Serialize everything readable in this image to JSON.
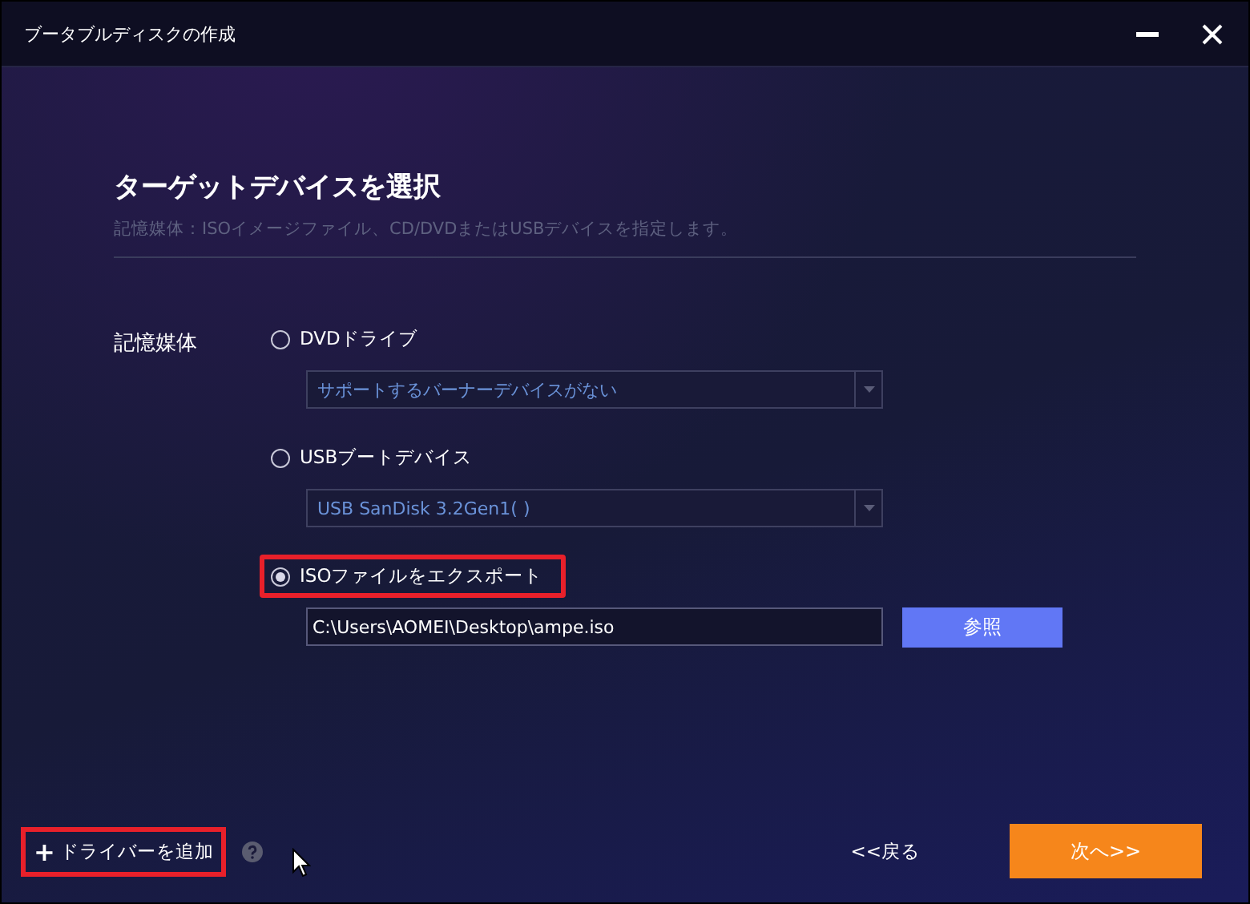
{
  "window": {
    "title": "ブータブルディスクの作成"
  },
  "heading": "ターゲットデバイスを選択",
  "subtitle": "記憶媒体：ISOイメージファイル、CD/DVDまたはUSBデバイスを指定します。",
  "media_label": "記憶媒体",
  "options": [
    {
      "kind": "dropdown",
      "label": "DVDドライブ",
      "selected": false,
      "highlighted": false,
      "value": "サポートするバーナーデバイスがない"
    },
    {
      "kind": "dropdown",
      "label": "USBブートデバイス",
      "selected": false,
      "highlighted": false,
      "value": "USB SanDisk 3.2Gen1( )"
    },
    {
      "kind": "path",
      "label": "ISOファイルをエクスポート",
      "selected": true,
      "highlighted": true,
      "value": "C:\\Users\\AOMEI\\Desktop\\ampe.iso",
      "button": "参照"
    }
  ],
  "footer": {
    "add_driver": {
      "icon": "+",
      "label": "ドライバーを追加",
      "highlighted": true
    },
    "back": "<<戻る",
    "next": "次へ>>"
  }
}
